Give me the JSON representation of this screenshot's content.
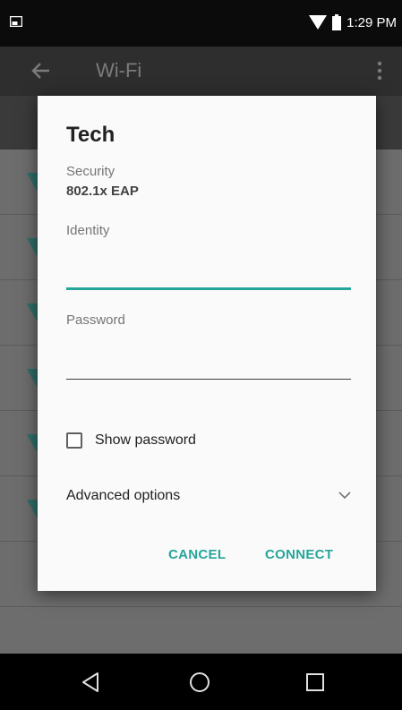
{
  "status_bar": {
    "time": "1:29 PM",
    "icons": [
      "screenshot-icon",
      "wifi-signal-icon",
      "battery-icon"
    ]
  },
  "app_bar": {
    "title": "Wi-Fi",
    "icons": [
      "back-arrow-icon",
      "overflow-menu-icon"
    ]
  },
  "dialog": {
    "title": "Tech",
    "security_label": "Security",
    "security_value": "802.1x EAP",
    "identity_label": "Identity",
    "identity_value": "",
    "password_label": "Password",
    "password_value": "",
    "show_password_label": "Show password",
    "show_password_checked": false,
    "advanced_options_label": "Advanced options",
    "cancel_label": "CANCEL",
    "connect_label": "CONNECT"
  },
  "nav_bar": {
    "icons": [
      "back-icon",
      "home-icon",
      "recents-icon"
    ]
  },
  "colors": {
    "accent": "#26a69a",
    "scrim": "#6d6d6d",
    "app_bar": "#2e2e2e",
    "status_bar": "#0b0b0b"
  }
}
